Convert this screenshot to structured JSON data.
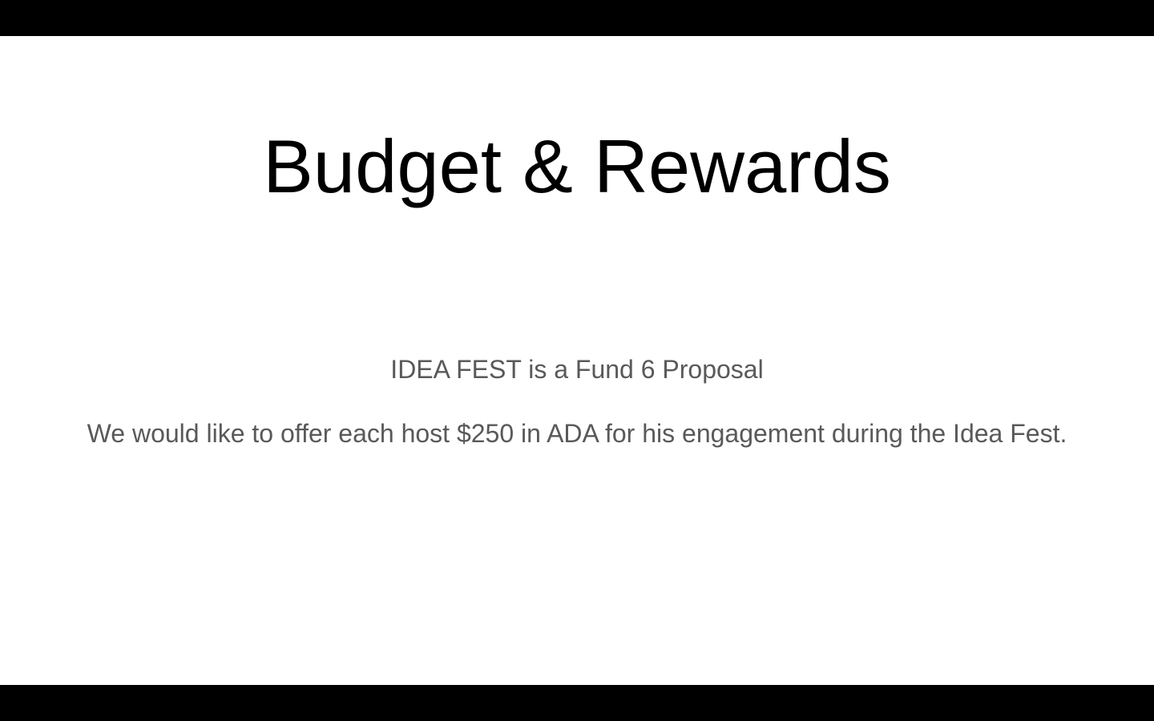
{
  "slide": {
    "title": "Budget & Rewards",
    "body": {
      "line1": "IDEA FEST is a Fund 6 Proposal",
      "line2": "We would like to offer each host $250 in ADA for his engagement during the Idea Fest."
    }
  },
  "colors": {
    "background": "#000000",
    "slide": "#ffffff",
    "title_text": "#000000",
    "body_text": "#595959"
  }
}
